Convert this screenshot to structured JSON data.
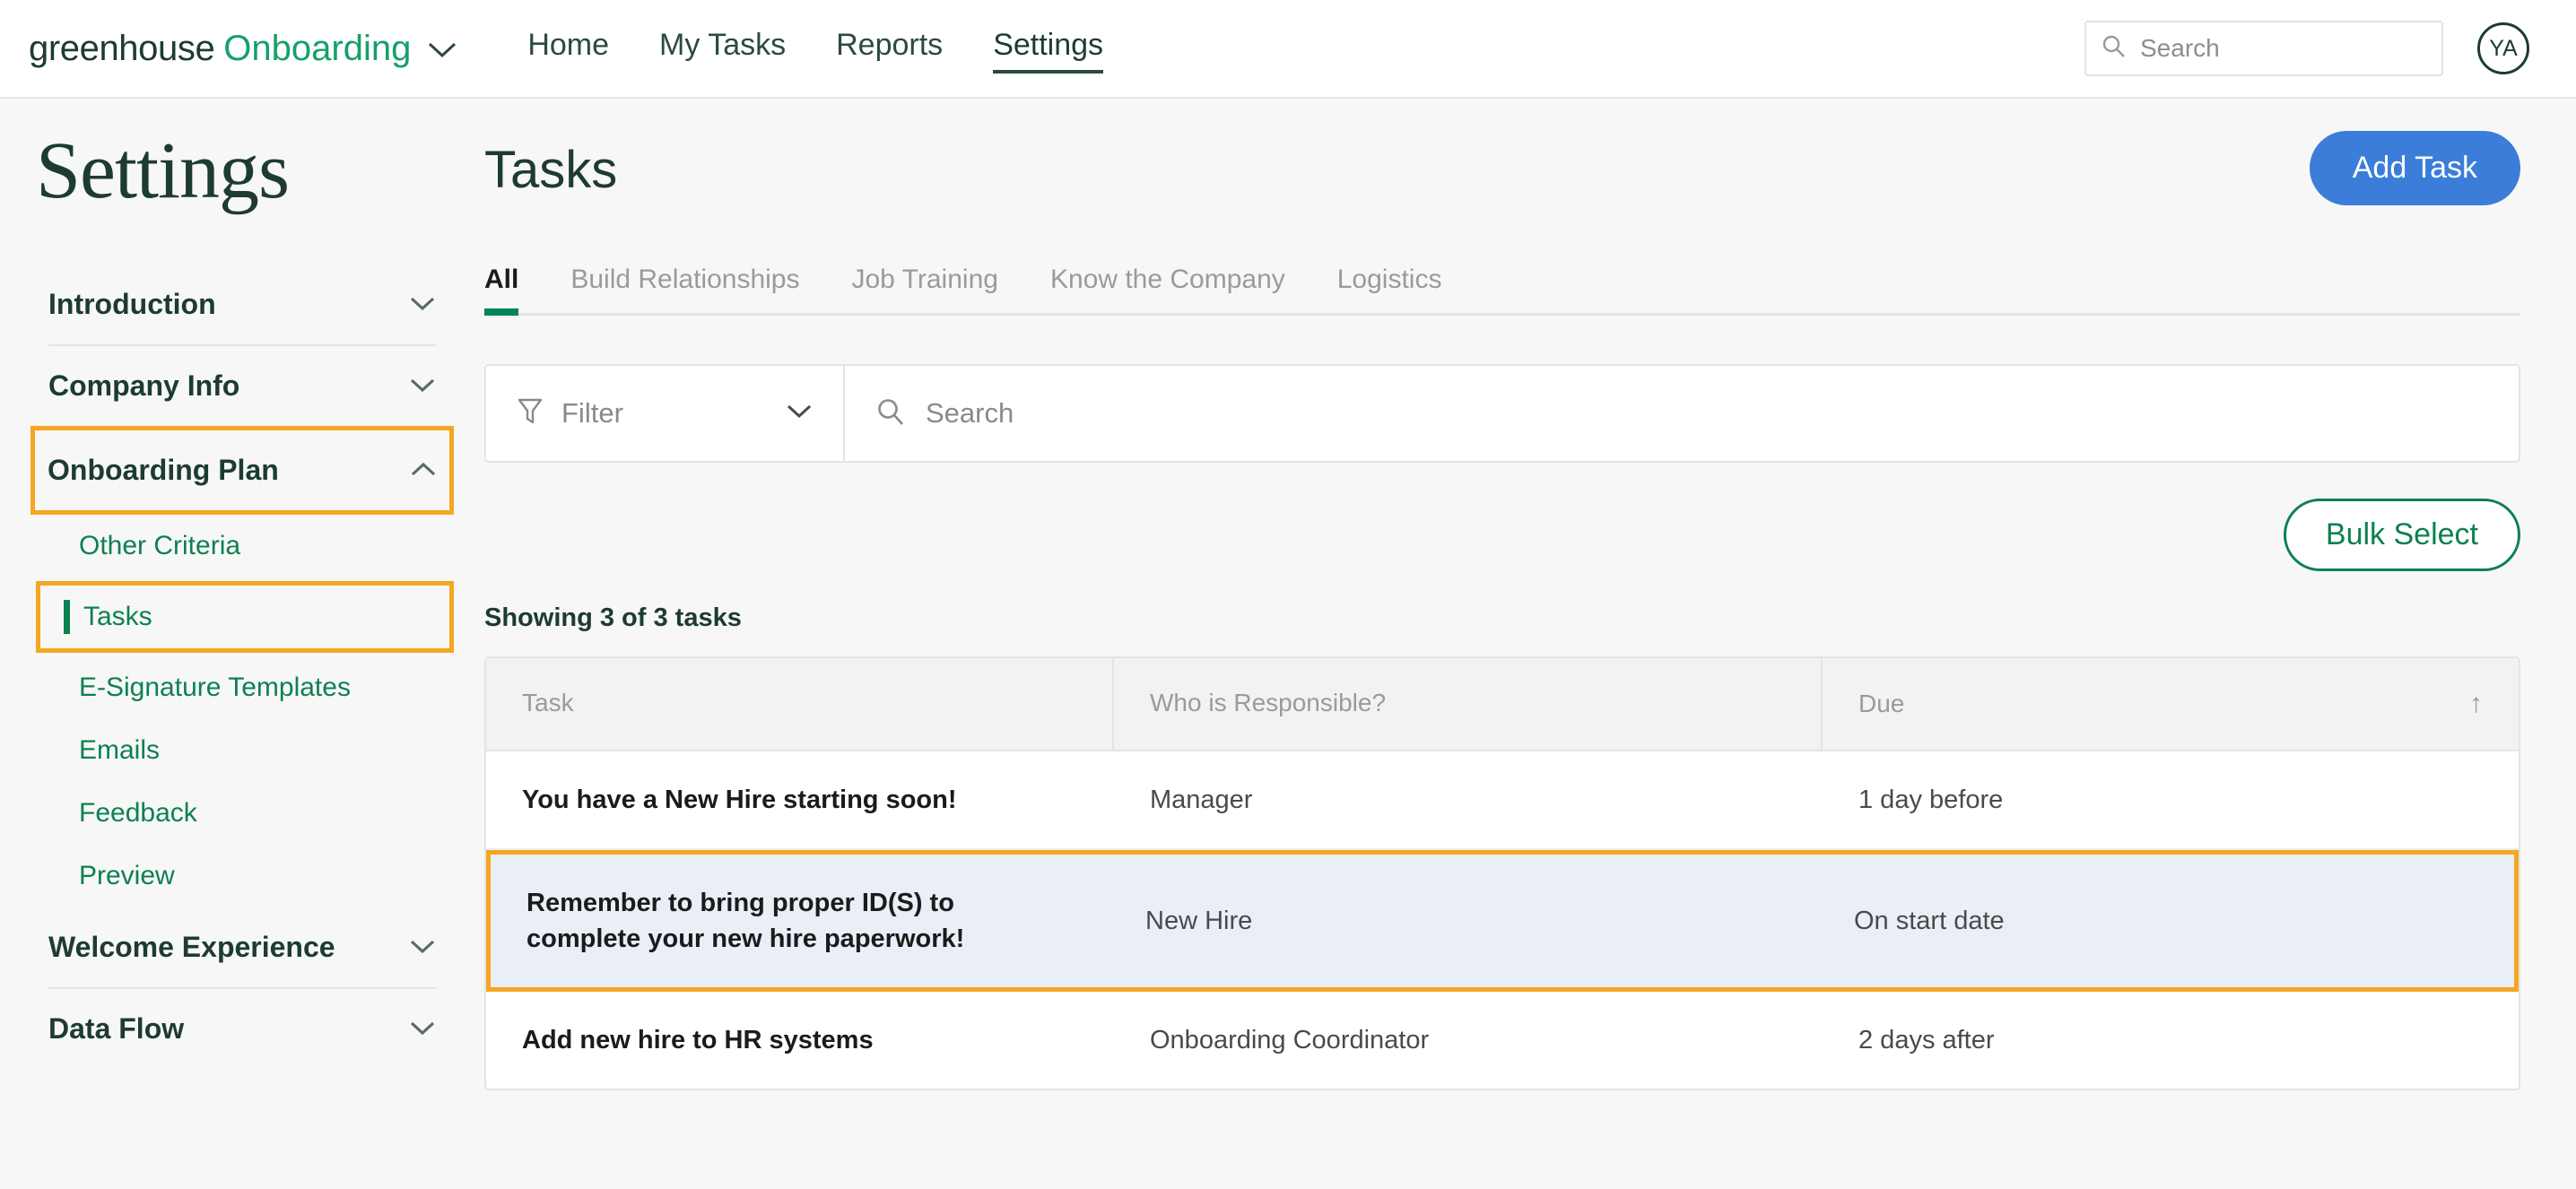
{
  "topnav": {
    "brand_primary": "greenhouse",
    "brand_secondary": "Onboarding",
    "brand_caret_icon": "chevron-down-icon",
    "links": [
      {
        "label": "Home",
        "active": false
      },
      {
        "label": "My Tasks",
        "active": false
      },
      {
        "label": "Reports",
        "active": false
      },
      {
        "label": "Settings",
        "active": true
      }
    ],
    "search": {
      "placeholder": "Search",
      "value": "",
      "icon": "search-icon"
    },
    "avatar_initials": "YA"
  },
  "sidebar": {
    "page_title": "Settings",
    "sections": [
      {
        "label": "Introduction",
        "state": "collapsed",
        "icon": "chevron-down-icon",
        "highlighted": false
      },
      {
        "label": "Company Info",
        "state": "collapsed",
        "icon": "chevron-down-icon",
        "highlighted": false
      },
      {
        "label": "Onboarding Plan",
        "state": "expanded",
        "icon": "chevron-up-icon",
        "highlighted": true
      },
      {
        "label": "Welcome Experience",
        "state": "collapsed",
        "icon": "chevron-down-icon",
        "highlighted": false
      },
      {
        "label": "Data Flow",
        "state": "collapsed",
        "icon": "chevron-down-icon",
        "highlighted": false
      }
    ],
    "onboarding_plan_items": [
      {
        "label": "Other Criteria",
        "current": false,
        "highlighted": false
      },
      {
        "label": "Tasks",
        "current": true,
        "highlighted": true
      },
      {
        "label": "E-Signature Templates",
        "current": false,
        "highlighted": false
      },
      {
        "label": "Emails",
        "current": false,
        "highlighted": false
      },
      {
        "label": "Feedback",
        "current": false,
        "highlighted": false
      },
      {
        "label": "Preview",
        "current": false,
        "highlighted": false
      }
    ]
  },
  "main": {
    "title": "Tasks",
    "add_task_label": "Add Task",
    "bulk_select_label": "Bulk Select",
    "tabs": [
      {
        "label": "All",
        "active": true
      },
      {
        "label": "Build Relationships",
        "active": false
      },
      {
        "label": "Job Training",
        "active": false
      },
      {
        "label": "Know the Company",
        "active": false
      },
      {
        "label": "Logistics",
        "active": false
      }
    ],
    "filter": {
      "label": "Filter",
      "icon": "funnel-icon",
      "chevron": "chevron-down-icon"
    },
    "search": {
      "placeholder": "Search",
      "value": "",
      "icon": "search-icon"
    },
    "showing_text": "Showing 3 of 3 tasks",
    "table": {
      "columns": [
        "Task",
        "Who is Responsible?",
        "Due"
      ],
      "sort": {
        "column": "Due",
        "direction": "asc",
        "glyph": "↑"
      },
      "rows": [
        {
          "task": "You have a New Hire starting soon!",
          "responsible": "Manager",
          "due": "1 day before",
          "highlighted": false
        },
        {
          "task": "Remember to bring proper ID(S) to complete your new hire paperwork!",
          "responsible": "New Hire",
          "due": "On start date",
          "highlighted": true
        },
        {
          "task": "Add new hire to HR systems",
          "responsible": "Onboarding Coordinator",
          "due": "2 days after",
          "highlighted": false
        }
      ]
    }
  },
  "colors": {
    "brand_green": "#16a06a",
    "dark_green": "#1d3b33",
    "link_green": "#0e8050",
    "accent_blue": "#3b7dd8",
    "highlight_orange": "#f5a623",
    "row_highlight_bg": "#e9eef7",
    "tab_underline_green": "#008556"
  }
}
